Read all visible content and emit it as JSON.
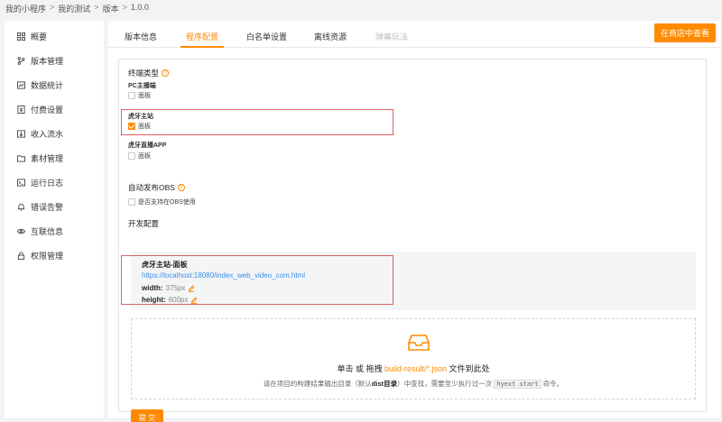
{
  "breadcrumb": [
    "我的小程序",
    "我的测试",
    "版本",
    "1.0.0"
  ],
  "breadcrumb_sep": ">",
  "sidebar": {
    "items": [
      {
        "label": "概要",
        "icon": "grid-icon"
      },
      {
        "label": "版本管理",
        "icon": "branch-icon"
      },
      {
        "label": "数据统计",
        "icon": "chart-icon"
      },
      {
        "label": "付费设置",
        "icon": "payment-icon"
      },
      {
        "label": "收入流水",
        "icon": "income-icon"
      },
      {
        "label": "素材管理",
        "icon": "folder-icon"
      },
      {
        "label": "运行日志",
        "icon": "terminal-icon"
      },
      {
        "label": "错误告警",
        "icon": "bell-icon"
      },
      {
        "label": "互联信息",
        "icon": "eye-icon"
      },
      {
        "label": "权限管理",
        "icon": "lock-icon"
      }
    ]
  },
  "tabs": [
    {
      "label": "版本信息",
      "state": "normal"
    },
    {
      "label": "程序配置",
      "state": "active"
    },
    {
      "label": "白名单设置",
      "state": "normal"
    },
    {
      "label": "离线资源",
      "state": "normal"
    },
    {
      "label": "弹幕玩法",
      "state": "disabled"
    }
  ],
  "store_button": "在商店中查看",
  "terminal": {
    "title": "终端类型",
    "groups": [
      {
        "name": "PC主播端",
        "option": "面板",
        "checked": false
      },
      {
        "name": "虎牙主站",
        "option": "面板",
        "checked": true
      },
      {
        "name": "虎牙直播APP",
        "option": "面板",
        "checked": false
      }
    ]
  },
  "obs": {
    "title": "自动发布OBS",
    "option": "是否支持在OBS使用",
    "checked": false
  },
  "dev": {
    "title": "开发配置",
    "name": "虎牙主站-面板",
    "url": "https://localhost:18080/index_web_video_com.html",
    "width_label": "width:",
    "width_value": "375px",
    "height_label": "height:",
    "height_value": "600px"
  },
  "upload": {
    "main_prefix": "单击 或 拖拽 ",
    "main_highlight": "build-result/*.json",
    "main_suffix": " 文件到此处",
    "sub_prefix": "请在项目的构建结果输出目录（默认",
    "sub_bold": "dist目录",
    "sub_mid": "）中查找，需要至少执行过一次",
    "sub_code": "hyext start",
    "sub_suffix": "命令。"
  },
  "submit_label": "提 交",
  "colors": {
    "accent": "#ff8a00",
    "link": "#3a8ee6",
    "highlight_border": "#e06060"
  }
}
